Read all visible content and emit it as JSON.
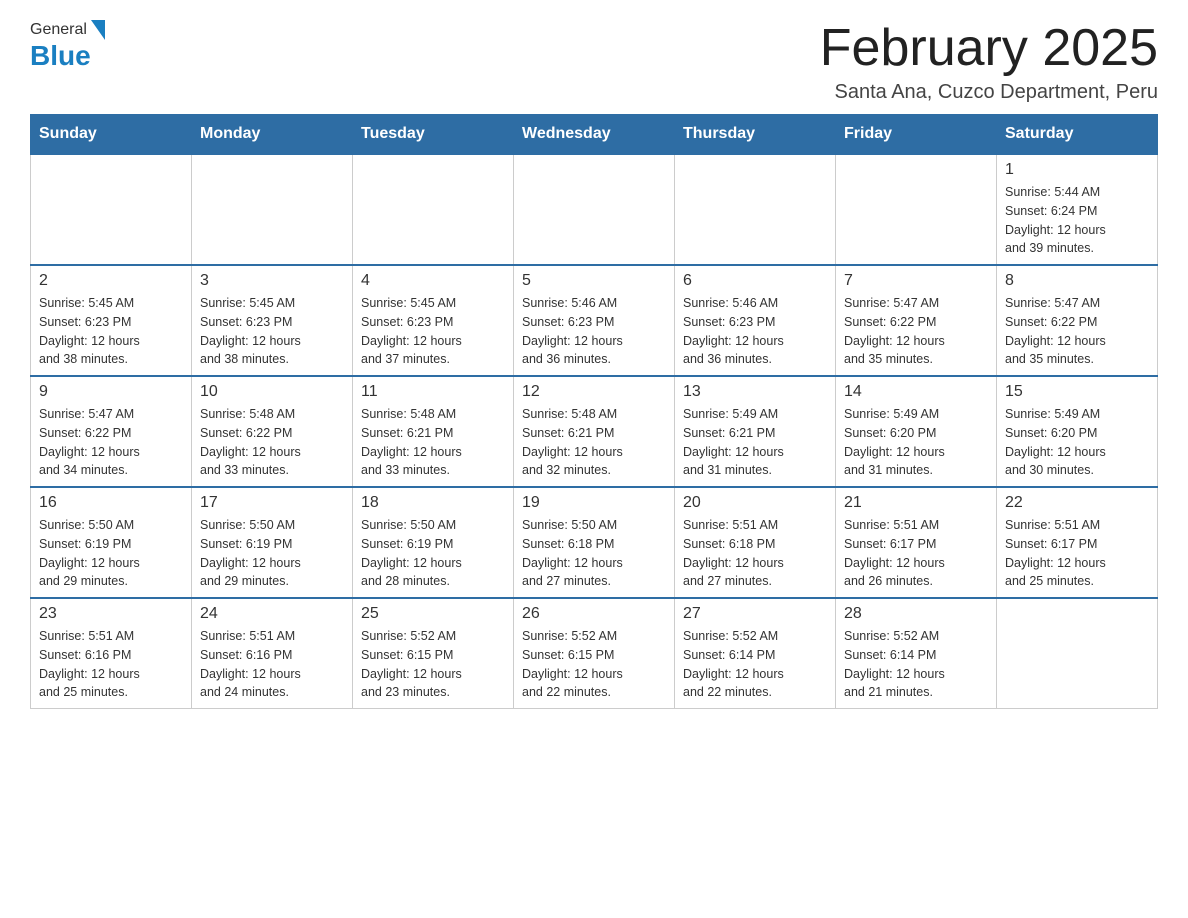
{
  "header": {
    "logo_general": "General",
    "logo_blue": "Blue",
    "month_title": "February 2025",
    "location": "Santa Ana, Cuzco Department, Peru"
  },
  "weekdays": [
    "Sunday",
    "Monday",
    "Tuesday",
    "Wednesday",
    "Thursday",
    "Friday",
    "Saturday"
  ],
  "weeks": [
    [
      {
        "day": "",
        "info": ""
      },
      {
        "day": "",
        "info": ""
      },
      {
        "day": "",
        "info": ""
      },
      {
        "day": "",
        "info": ""
      },
      {
        "day": "",
        "info": ""
      },
      {
        "day": "",
        "info": ""
      },
      {
        "day": "1",
        "info": "Sunrise: 5:44 AM\nSunset: 6:24 PM\nDaylight: 12 hours\nand 39 minutes."
      }
    ],
    [
      {
        "day": "2",
        "info": "Sunrise: 5:45 AM\nSunset: 6:23 PM\nDaylight: 12 hours\nand 38 minutes."
      },
      {
        "day": "3",
        "info": "Sunrise: 5:45 AM\nSunset: 6:23 PM\nDaylight: 12 hours\nand 38 minutes."
      },
      {
        "day": "4",
        "info": "Sunrise: 5:45 AM\nSunset: 6:23 PM\nDaylight: 12 hours\nand 37 minutes."
      },
      {
        "day": "5",
        "info": "Sunrise: 5:46 AM\nSunset: 6:23 PM\nDaylight: 12 hours\nand 36 minutes."
      },
      {
        "day": "6",
        "info": "Sunrise: 5:46 AM\nSunset: 6:23 PM\nDaylight: 12 hours\nand 36 minutes."
      },
      {
        "day": "7",
        "info": "Sunrise: 5:47 AM\nSunset: 6:22 PM\nDaylight: 12 hours\nand 35 minutes."
      },
      {
        "day": "8",
        "info": "Sunrise: 5:47 AM\nSunset: 6:22 PM\nDaylight: 12 hours\nand 35 minutes."
      }
    ],
    [
      {
        "day": "9",
        "info": "Sunrise: 5:47 AM\nSunset: 6:22 PM\nDaylight: 12 hours\nand 34 minutes."
      },
      {
        "day": "10",
        "info": "Sunrise: 5:48 AM\nSunset: 6:22 PM\nDaylight: 12 hours\nand 33 minutes."
      },
      {
        "day": "11",
        "info": "Sunrise: 5:48 AM\nSunset: 6:21 PM\nDaylight: 12 hours\nand 33 minutes."
      },
      {
        "day": "12",
        "info": "Sunrise: 5:48 AM\nSunset: 6:21 PM\nDaylight: 12 hours\nand 32 minutes."
      },
      {
        "day": "13",
        "info": "Sunrise: 5:49 AM\nSunset: 6:21 PM\nDaylight: 12 hours\nand 31 minutes."
      },
      {
        "day": "14",
        "info": "Sunrise: 5:49 AM\nSunset: 6:20 PM\nDaylight: 12 hours\nand 31 minutes."
      },
      {
        "day": "15",
        "info": "Sunrise: 5:49 AM\nSunset: 6:20 PM\nDaylight: 12 hours\nand 30 minutes."
      }
    ],
    [
      {
        "day": "16",
        "info": "Sunrise: 5:50 AM\nSunset: 6:19 PM\nDaylight: 12 hours\nand 29 minutes."
      },
      {
        "day": "17",
        "info": "Sunrise: 5:50 AM\nSunset: 6:19 PM\nDaylight: 12 hours\nand 29 minutes."
      },
      {
        "day": "18",
        "info": "Sunrise: 5:50 AM\nSunset: 6:19 PM\nDaylight: 12 hours\nand 28 minutes."
      },
      {
        "day": "19",
        "info": "Sunrise: 5:50 AM\nSunset: 6:18 PM\nDaylight: 12 hours\nand 27 minutes."
      },
      {
        "day": "20",
        "info": "Sunrise: 5:51 AM\nSunset: 6:18 PM\nDaylight: 12 hours\nand 27 minutes."
      },
      {
        "day": "21",
        "info": "Sunrise: 5:51 AM\nSunset: 6:17 PM\nDaylight: 12 hours\nand 26 minutes."
      },
      {
        "day": "22",
        "info": "Sunrise: 5:51 AM\nSunset: 6:17 PM\nDaylight: 12 hours\nand 25 minutes."
      }
    ],
    [
      {
        "day": "23",
        "info": "Sunrise: 5:51 AM\nSunset: 6:16 PM\nDaylight: 12 hours\nand 25 minutes."
      },
      {
        "day": "24",
        "info": "Sunrise: 5:51 AM\nSunset: 6:16 PM\nDaylight: 12 hours\nand 24 minutes."
      },
      {
        "day": "25",
        "info": "Sunrise: 5:52 AM\nSunset: 6:15 PM\nDaylight: 12 hours\nand 23 minutes."
      },
      {
        "day": "26",
        "info": "Sunrise: 5:52 AM\nSunset: 6:15 PM\nDaylight: 12 hours\nand 22 minutes."
      },
      {
        "day": "27",
        "info": "Sunrise: 5:52 AM\nSunset: 6:14 PM\nDaylight: 12 hours\nand 22 minutes."
      },
      {
        "day": "28",
        "info": "Sunrise: 5:52 AM\nSunset: 6:14 PM\nDaylight: 12 hours\nand 21 minutes."
      },
      {
        "day": "",
        "info": ""
      }
    ]
  ]
}
